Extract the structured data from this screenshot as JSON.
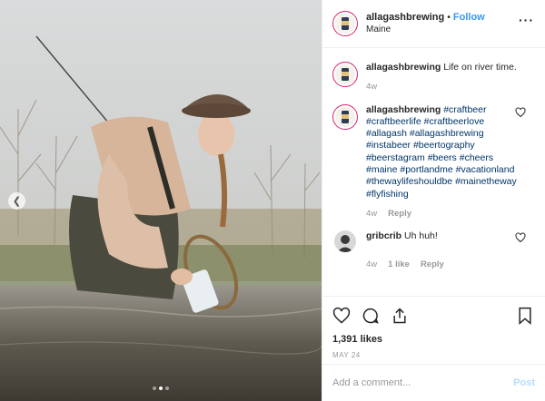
{
  "post": {
    "username": "allagashbrewing",
    "follow_label": "Follow",
    "separator": "•",
    "location": "Maine",
    "more_icon": "more-dots-icon"
  },
  "photo": {
    "prev_icon": "chevron-left-icon",
    "dots": 3,
    "active_dot": 1
  },
  "comments": [
    {
      "username": "allagashbrewing",
      "text": "Life on river time.",
      "time": "4w"
    },
    {
      "username": "allagashbrewing",
      "hashtags": "#craftbeer #craftbeerlife #craftbeerlove #allagash #allagashbrewing #instabeer #beertography #beerstagram #beers #cheers #maine #portlandme #vacationland #thewaylifeshouldbe #mainetheway #flyfishing",
      "time": "4w",
      "reply": "Reply"
    },
    {
      "username": "gribcrib",
      "text": "Uh huh!",
      "time": "4w",
      "likes": "1 like",
      "reply": "Reply"
    }
  ],
  "actions": {
    "likes": "1,391 likes",
    "date": "MAY 24"
  },
  "add_comment": {
    "placeholder": "Add a comment...",
    "post_label": "Post"
  }
}
